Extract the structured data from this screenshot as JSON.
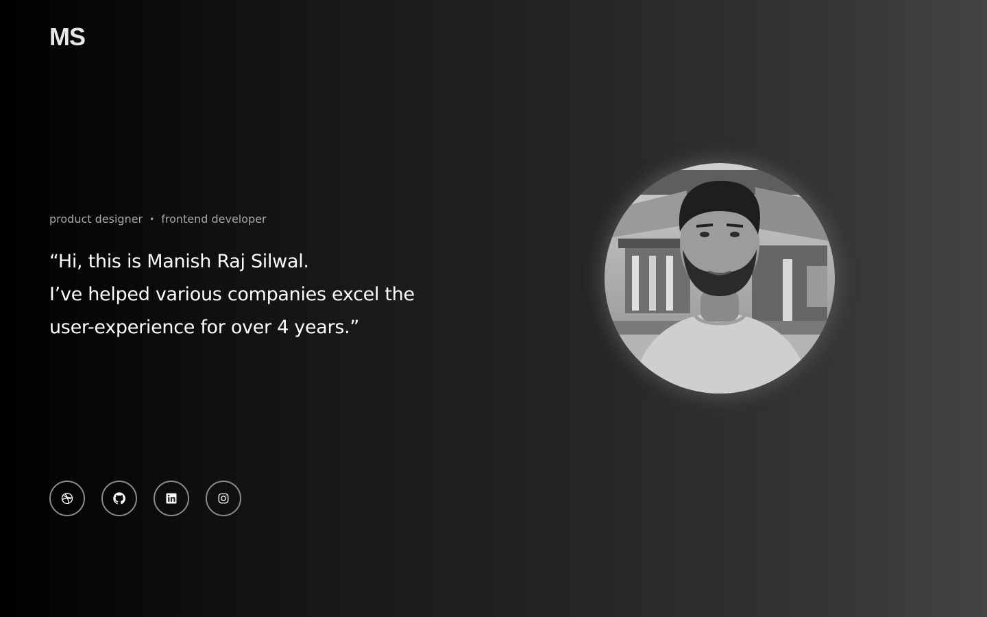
{
  "brand": {
    "logo_text": "MS"
  },
  "hero": {
    "roles": [
      "product designer",
      "frontend developer"
    ],
    "separator": "•",
    "quote_lines": [
      "“Hi, this is Manish Raj Silwal.",
      "I’ve helped various companies excel the",
      "user-experience for over 4 years.”"
    ]
  },
  "social": [
    {
      "name": "dribbble",
      "icon": "dribbble-icon"
    },
    {
      "name": "github",
      "icon": "github-icon"
    },
    {
      "name": "linkedin",
      "icon": "linkedin-icon"
    },
    {
      "name": "instagram",
      "icon": "instagram-icon"
    }
  ],
  "avatar": {
    "icon": "profile-photo",
    "style": "grayscale"
  },
  "colors": {
    "background_start": "#000000",
    "background_end": "#444444",
    "text_primary": "#ffffff",
    "text_muted": "#a9a9a9",
    "icon_border": "#8c8c8c"
  }
}
